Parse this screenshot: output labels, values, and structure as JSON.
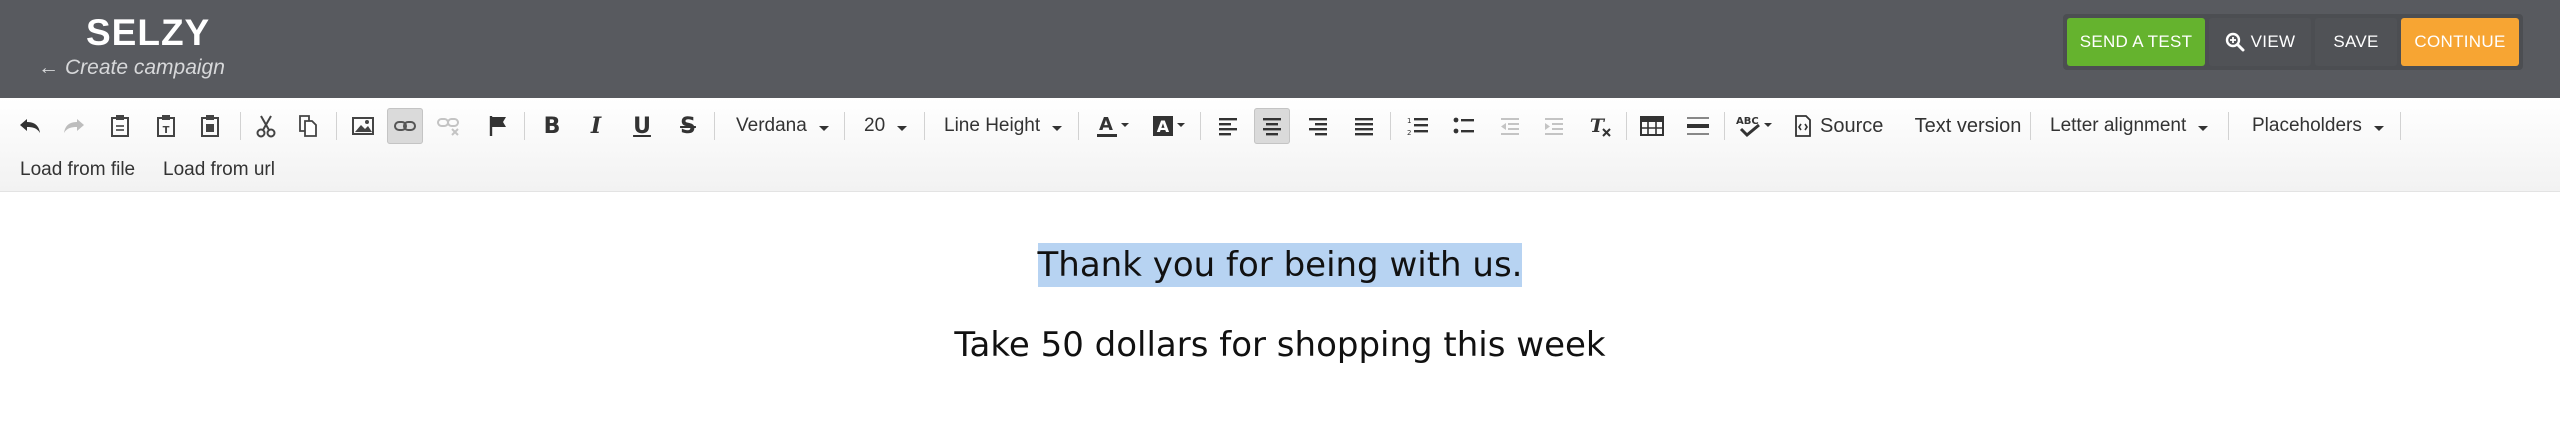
{
  "app": {
    "logo": "SELZY",
    "back_arrow": "←",
    "back_label": "Create campaign"
  },
  "actions": {
    "send_test": "SEND A TEST",
    "view": "VIEW",
    "save": "SAVE",
    "continue": "CONTINUE"
  },
  "toolbar": {
    "font_family": "Verdana",
    "font_size": "20",
    "line_height": "Line Height",
    "source": "Source",
    "text_version": "Text version",
    "letter_alignment": "Letter alignment",
    "placeholders": "Placeholders",
    "load_from_file": "Load from file",
    "load_from_url": "Load from url",
    "bold_glyph": "B",
    "italic_glyph": "I",
    "underline_glyph": "U",
    "strike_glyph": "S",
    "icons": [
      "undo-icon",
      "redo-icon",
      "paste-icon",
      "paste-text-icon",
      "paste-word-icon",
      "cut-icon",
      "copy-icon",
      "image-icon",
      "link-icon",
      "unlink-icon",
      "anchor-flag-icon",
      "bold-icon",
      "italic-icon",
      "underline-icon",
      "strikethrough-icon",
      "text-color-icon",
      "background-color-icon",
      "align-left-icon",
      "align-center-icon",
      "align-right-icon",
      "align-justify-icon",
      "numbered-list-icon",
      "bulleted-list-icon",
      "outdent-icon",
      "indent-icon",
      "clear-format-icon",
      "table-icon",
      "horizontal-rule-icon",
      "spellcheck-icon",
      "source-icon"
    ]
  },
  "content": {
    "line1": "Thank you for being with us.",
    "line2": "Take 50 dollars for shopping this week"
  },
  "colors": {
    "header_bg": "#585a5f",
    "send_test": "#65b32e",
    "continue": "#f7a533",
    "selection": "#b7d3f2"
  }
}
